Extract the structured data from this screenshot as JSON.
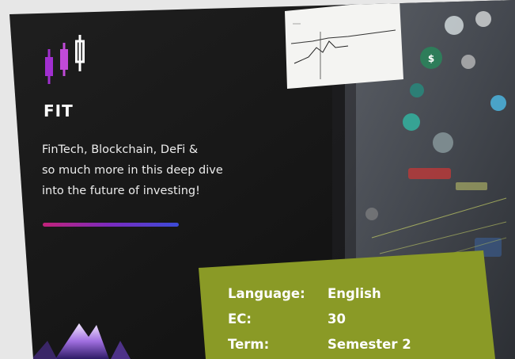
{
  "brand": {
    "name": "FIT"
  },
  "tagline": {
    "line1": "FinTech, Blockchain, DeFi &",
    "line2": "so much more in this deep dive",
    "line3": "into the future of investing!"
  },
  "course_info": {
    "rows": [
      {
        "label": "Language:",
        "value": "English"
      },
      {
        "label": "EC:",
        "value": "30"
      },
      {
        "label": "Term:",
        "value": "Semester 2"
      }
    ]
  },
  "colors": {
    "card_dark": "#161616",
    "info_box": "#8a9a26",
    "accent_start": "#c2227a",
    "accent_end": "#3b4bd8",
    "logo_purple": "#a12fd0"
  },
  "icons": {
    "logo": "candlestick-chart-icon"
  }
}
